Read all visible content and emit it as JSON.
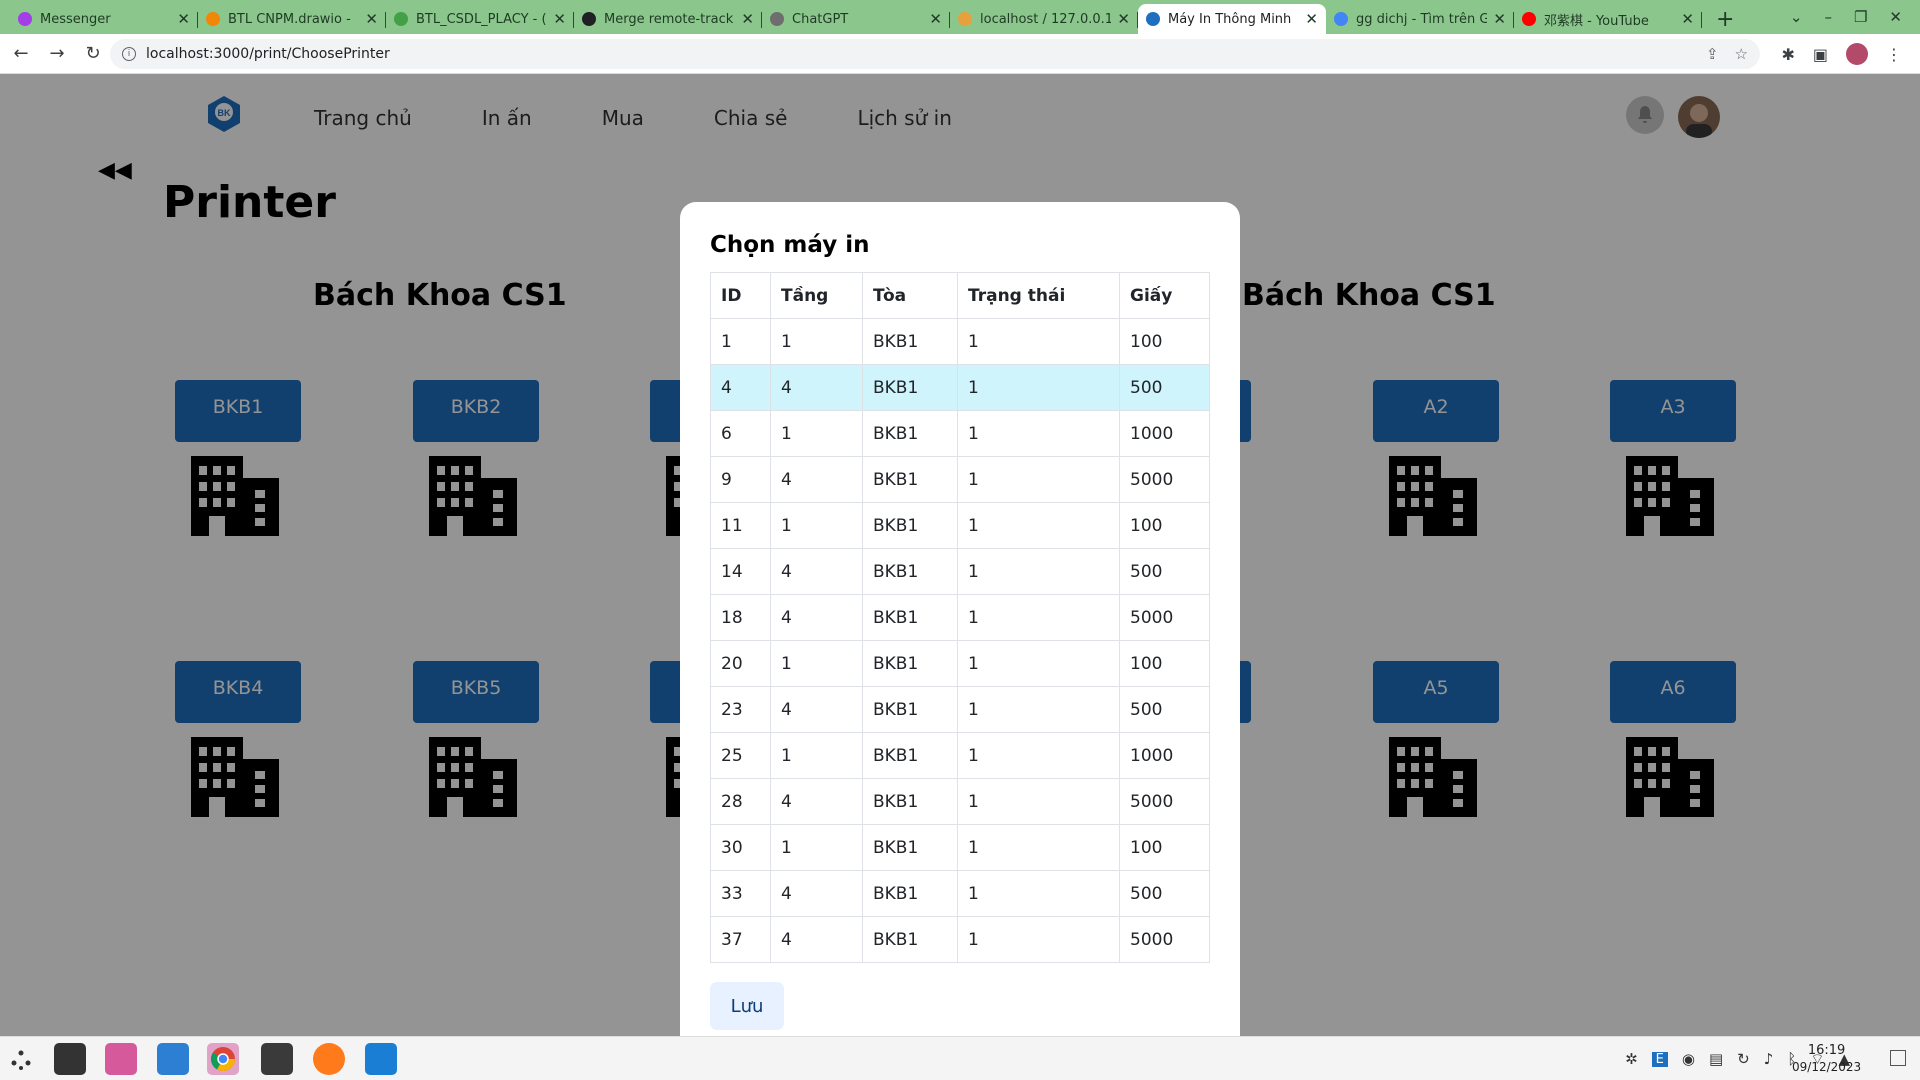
{
  "browser": {
    "tabs": [
      {
        "label": "Messenger",
        "color": "#a33ee8"
      },
      {
        "label": "BTL CNPM.drawio - ",
        "color": "#f08705"
      },
      {
        "label": "BTL_CSDL_PLACY - (",
        "color": "#43a047"
      },
      {
        "label": "Merge remote-track",
        "color": "#202124"
      },
      {
        "label": "ChatGPT",
        "color": "#6e6e6e"
      },
      {
        "label": "localhost / 127.0.0.1",
        "color": "#e6a03c"
      },
      {
        "label": "Máy In Thông Minh",
        "color": "#1e6fc0",
        "active": true
      },
      {
        "label": "gg dichj - Tìm trên G",
        "color": "#4285f4"
      },
      {
        "label": "邓紫棋 - YouTube",
        "color": "#ff0000"
      }
    ],
    "url": "localhost:3000/print/ChoosePrinter"
  },
  "nav": {
    "links": [
      "Trang chủ",
      "In ấn",
      "Mua",
      "Chia sẻ",
      "Lịch sử in"
    ]
  },
  "page": {
    "title": "Printer",
    "campus_left": "Bách Khoa CS1",
    "campus_right": "Bách Khoa CS1",
    "buildings_row1": [
      "BKB1",
      "BKB2",
      "",
      "",
      "",
      "A2",
      "A3"
    ],
    "buildings_row2": [
      "BKB4",
      "BKB5",
      "",
      "",
      "",
      "A5",
      "A6"
    ]
  },
  "modal": {
    "title": "Chọn máy in",
    "headers": [
      "ID",
      "Tầng",
      "Tòa",
      "Trạng thái",
      "Giấy"
    ],
    "rows": [
      [
        "1",
        "1",
        "BKB1",
        "1",
        "100"
      ],
      [
        "4",
        "4",
        "BKB1",
        "1",
        "500"
      ],
      [
        "6",
        "1",
        "BKB1",
        "1",
        "1000"
      ],
      [
        "9",
        "4",
        "BKB1",
        "1",
        "5000"
      ],
      [
        "11",
        "1",
        "BKB1",
        "1",
        "100"
      ],
      [
        "14",
        "4",
        "BKB1",
        "1",
        "500"
      ],
      [
        "18",
        "4",
        "BKB1",
        "1",
        "5000"
      ],
      [
        "20",
        "1",
        "BKB1",
        "1",
        "100"
      ],
      [
        "23",
        "4",
        "BKB1",
        "1",
        "500"
      ],
      [
        "25",
        "1",
        "BKB1",
        "1",
        "1000"
      ],
      [
        "28",
        "4",
        "BKB1",
        "1",
        "5000"
      ],
      [
        "30",
        "1",
        "BKB1",
        "1",
        "100"
      ],
      [
        "33",
        "4",
        "BKB1",
        "1",
        "500"
      ],
      [
        "37",
        "4",
        "BKB1",
        "1",
        "5000"
      ]
    ],
    "selected_row": 1,
    "save_label": "Lưu"
  },
  "taskbar": {
    "time": "16:19",
    "date": "09/12/2023"
  },
  "colors": {
    "accent": "#1e6fc0",
    "selected_row": "#cff4fc",
    "tabbar": "#8bc78d"
  }
}
